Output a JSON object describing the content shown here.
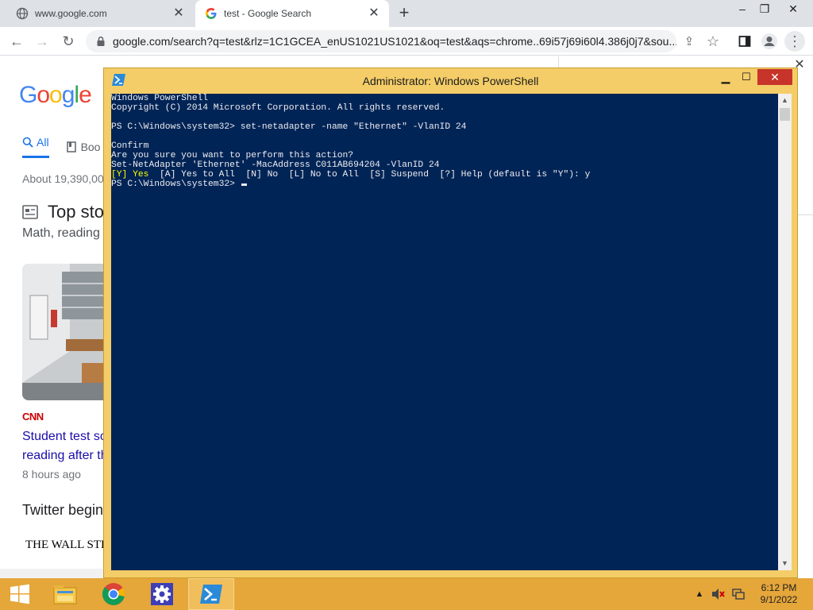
{
  "browser": {
    "tabs": [
      {
        "title": "www.google.com",
        "active": false
      },
      {
        "title": "test - Google Search",
        "active": true
      }
    ],
    "url": "google.com/search?q=test&rlz=1C1GCEA_enUS1021US1021&oq=test&aqs=chrome..69i57j69i60l4.386j0j7&sou..."
  },
  "google": {
    "logo": "Google",
    "tabs": {
      "all": "All",
      "books": "Boo"
    },
    "result_count": "About 19,390,00",
    "top_stories": "Top sto",
    "subtitle": "Math, reading",
    "source": "CNN",
    "story_link_line1": "Student test sc",
    "story_link_line2": "reading after th",
    "story_time": "8 hours ago",
    "twitter_heading": "Twitter begin",
    "wsj": "THE WALL STREET"
  },
  "powershell": {
    "title": "Administrator: Windows PowerShell",
    "console_lines": [
      "Windows PowerShell",
      "Copyright (C) 2014 Microsoft Corporation. All rights reserved.",
      "",
      "PS C:\\Windows\\system32> set-netadapter -name \"Ethernet\" -VlanID 24",
      "",
      "Confirm",
      "Are you sure you want to perform this action?",
      "Set-NetAdapter 'Ethernet' -MacAddress C011AB694204 -VlanID 24"
    ],
    "prompt_yes": "[Y] Yes",
    "prompt_rest": "  [A] Yes to All  [N] No  [L] No to All  [S] Suspend  [?] Help (default is \"Y\"): y",
    "current_prompt": "PS C:\\Windows\\system32> "
  },
  "taskbar": {
    "apps": [
      "start-button",
      "file-explorer-icon",
      "chrome-icon",
      "settings-icon",
      "powershell-icon"
    ],
    "time": "6:12 PM",
    "date": "9/1/2022",
    "accent": "#e5a63a"
  },
  "colors": {
    "console_bg": "#012456",
    "window_frame": "#f4cd68",
    "google_blue": "#1a73e8"
  }
}
